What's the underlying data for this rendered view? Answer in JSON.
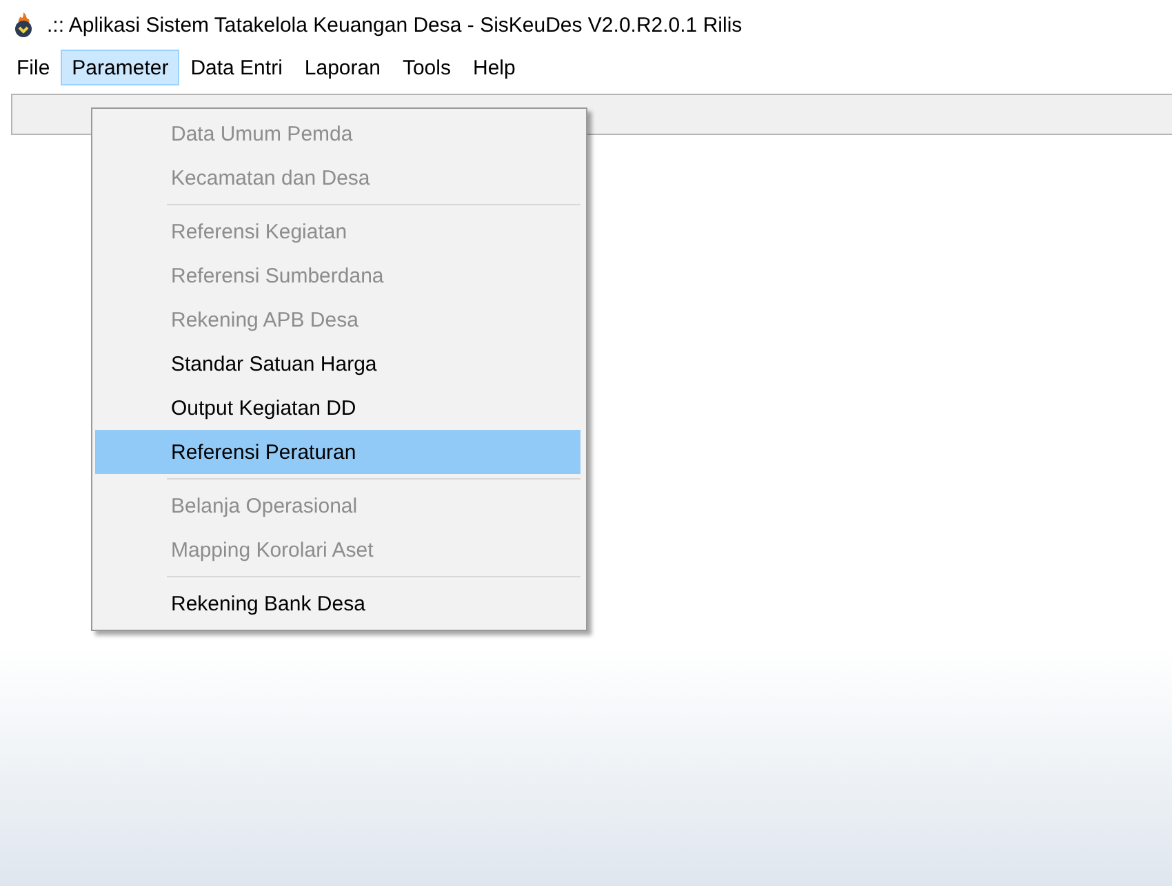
{
  "window": {
    "title": ".:: Aplikasi Sistem Tatakelola Keuangan Desa - SisKeuDes V2.0.R2.0.1 Rilis"
  },
  "menu_bar": [
    {
      "label": "File",
      "selected": false
    },
    {
      "label": "Parameter",
      "selected": true
    },
    {
      "label": "Data Entri",
      "selected": false
    },
    {
      "label": "Laporan",
      "selected": false
    },
    {
      "label": "Tools",
      "selected": false
    },
    {
      "label": "Help",
      "selected": false
    }
  ],
  "dropdown": [
    {
      "kind": "item",
      "label": "Data Umum Pemda",
      "disabled": true,
      "selected": false
    },
    {
      "kind": "item",
      "label": "Kecamatan dan Desa",
      "disabled": true,
      "selected": false
    },
    {
      "kind": "separator"
    },
    {
      "kind": "item",
      "label": "Referensi Kegiatan",
      "disabled": true,
      "selected": false
    },
    {
      "kind": "item",
      "label": "Referensi Sumberdana",
      "disabled": true,
      "selected": false
    },
    {
      "kind": "item",
      "label": "Rekening APB Desa",
      "disabled": true,
      "selected": false
    },
    {
      "kind": "item",
      "label": "Standar Satuan Harga",
      "disabled": false,
      "selected": false
    },
    {
      "kind": "item",
      "label": "Output Kegiatan DD",
      "disabled": false,
      "selected": false
    },
    {
      "kind": "item",
      "label": "Referensi Peraturan",
      "disabled": false,
      "selected": true
    },
    {
      "kind": "separator"
    },
    {
      "kind": "item",
      "label": "Belanja Operasional",
      "disabled": true,
      "selected": false
    },
    {
      "kind": "item",
      "label": "Mapping Korolari Aset",
      "disabled": true,
      "selected": false
    },
    {
      "kind": "separator"
    },
    {
      "kind": "item",
      "label": "Rekening Bank Desa",
      "disabled": false,
      "selected": false
    }
  ]
}
